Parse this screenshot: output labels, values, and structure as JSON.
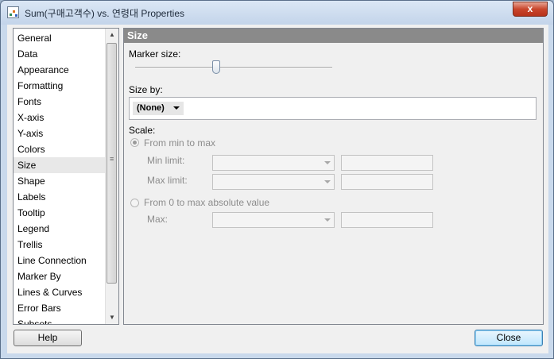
{
  "window": {
    "title": "Sum(구매고객수) vs. 연령대 Properties",
    "close_glyph": "x"
  },
  "sidebar": {
    "items": [
      {
        "label": "General"
      },
      {
        "label": "Data"
      },
      {
        "label": "Appearance"
      },
      {
        "label": "Formatting"
      },
      {
        "label": "Fonts"
      },
      {
        "label": "X-axis"
      },
      {
        "label": "Y-axis"
      },
      {
        "label": "Colors"
      },
      {
        "label": "Size",
        "selected": true
      },
      {
        "label": "Shape"
      },
      {
        "label": "Labels"
      },
      {
        "label": "Tooltip"
      },
      {
        "label": "Legend"
      },
      {
        "label": "Trellis"
      },
      {
        "label": "Line Connection"
      },
      {
        "label": "Marker By"
      },
      {
        "label": "Lines & Curves"
      },
      {
        "label": "Error Bars"
      },
      {
        "label": "Subsets"
      }
    ]
  },
  "panel": {
    "header": "Size",
    "marker_size_label": "Marker size:",
    "marker_size_level": 0.41,
    "size_by_label": "Size by:",
    "size_by_value": "(None)",
    "scale_label": "Scale:",
    "from_min_to_max": "From min to max",
    "min_limit_label": "Min limit:",
    "max_limit_label": "Max limit:",
    "from_zero_label": "From 0 to max absolute value",
    "max_label": "Max:"
  },
  "buttons": {
    "help": "Help",
    "close": "Close"
  },
  "colors": {
    "panel_header_bg": "#8a8a8a",
    "disabled_text": "#8c8c8c",
    "title_close_red": "#c9462c"
  }
}
